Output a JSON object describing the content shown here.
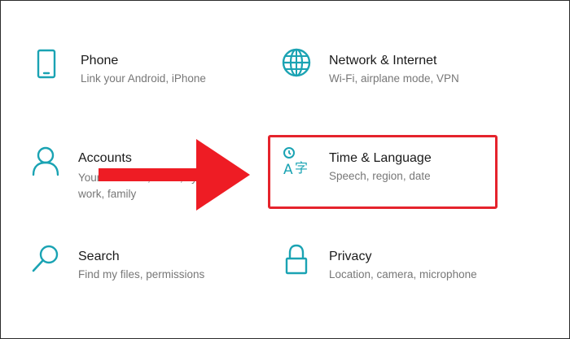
{
  "accent": "#1aa3b3",
  "highlight_color": "#e5232c",
  "tiles": [
    {
      "title": "Phone",
      "subtitle": "Link your Android, iPhone",
      "icon": "phone-icon"
    },
    {
      "title": "Network & Internet",
      "subtitle": "Wi-Fi, airplane mode, VPN",
      "icon": "globe-icon"
    },
    {
      "title": "Accounts",
      "subtitle_line1": "Your accounts, email, sync,",
      "subtitle_line2": "work, family",
      "icon": "person-icon"
    },
    {
      "title": "Time & Language",
      "subtitle": "Speech, region, date",
      "icon": "time-language-icon"
    },
    {
      "title": "Search",
      "subtitle": "Find my files, permissions",
      "icon": "search-icon"
    },
    {
      "title": "Privacy",
      "subtitle": "Location, camera, microphone",
      "icon": "lock-icon"
    }
  ]
}
